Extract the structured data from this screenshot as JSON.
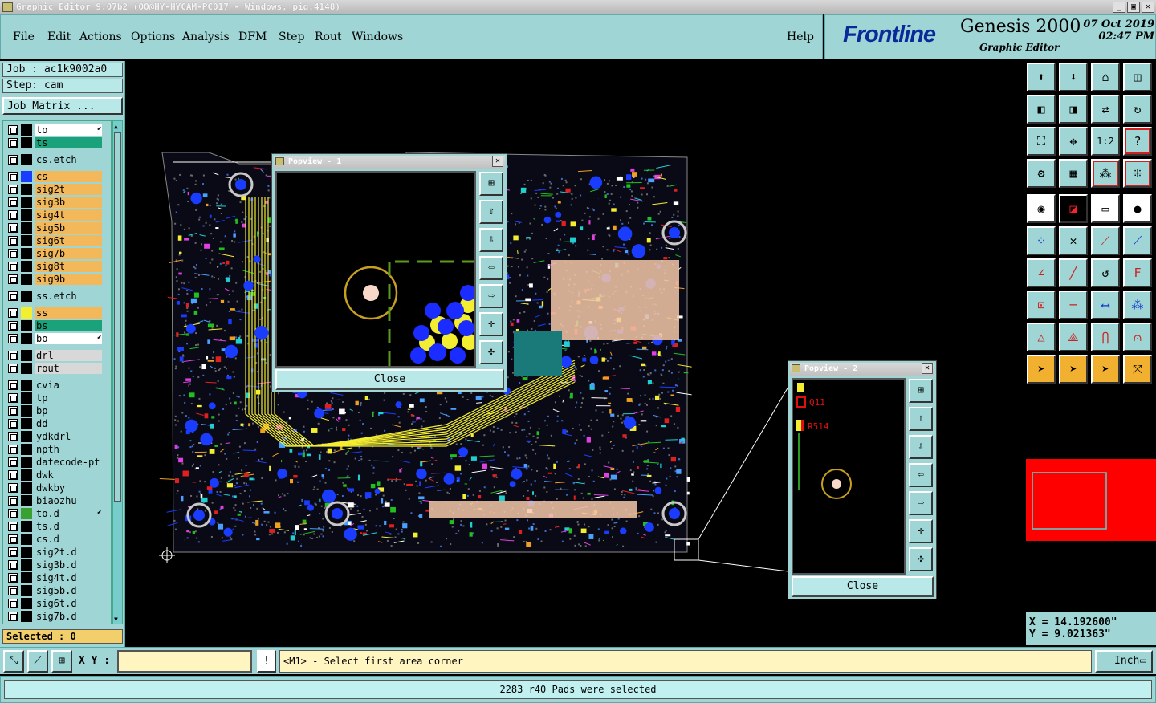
{
  "window": {
    "title": "Graphic Editor 9.07b2 (OO@HY-HYCAM-PC017 - Windows, pid:4148)"
  },
  "menu": {
    "items": [
      "File",
      "Edit",
      "Actions",
      "Options",
      "Analysis",
      "DFM",
      "Step",
      "Rout",
      "Windows"
    ],
    "help": "Help"
  },
  "brand": {
    "logo": "Frontline",
    "product": "Genesis 2000",
    "subtitle": "Graphic Editor",
    "date": "07 Oct 2019",
    "time": "02:47 PM"
  },
  "job": {
    "job": "Job : ac1k9002a0",
    "step": "Step: cam",
    "matrix_button": "Job Matrix ..."
  },
  "layers": [
    {
      "name": "to",
      "bg": "#ffffff",
      "swatch": "#000000",
      "arrow": true
    },
    {
      "name": "ts",
      "bg": "#1aa37a",
      "swatch": "#000000"
    },
    {
      "name": "cs.etch",
      "bg": "#9fd5d5",
      "swatch": "#000000",
      "gap": true
    },
    {
      "name": "cs",
      "bg": "#f2b85a",
      "swatch": "#1a3cff",
      "gap": true
    },
    {
      "name": "sig2t",
      "bg": "#f2b85a",
      "swatch": "#000000"
    },
    {
      "name": "sig3b",
      "bg": "#f2b85a",
      "swatch": "#000000"
    },
    {
      "name": "sig4t",
      "bg": "#f2b85a",
      "swatch": "#000000"
    },
    {
      "name": "sig5b",
      "bg": "#f2b85a",
      "swatch": "#000000"
    },
    {
      "name": "sig6t",
      "bg": "#f2b85a",
      "swatch": "#000000"
    },
    {
      "name": "sig7b",
      "bg": "#f2b85a",
      "swatch": "#000000"
    },
    {
      "name": "sig8t",
      "bg": "#f2b85a",
      "swatch": "#000000"
    },
    {
      "name": "sig9b",
      "bg": "#f2b85a",
      "swatch": "#000000"
    },
    {
      "name": "ss.etch",
      "bg": "#9fd5d5",
      "swatch": "#000000",
      "gap": true
    },
    {
      "name": "ss",
      "bg": "#f2b85a",
      "swatch": "#f4ee30",
      "gap": true
    },
    {
      "name": "bs",
      "bg": "#1aa37a",
      "swatch": "#000000"
    },
    {
      "name": "bo",
      "bg": "#ffffff",
      "swatch": "#000000",
      "arrow": true
    },
    {
      "name": "drl",
      "bg": "#d8d8d8",
      "swatch": "#000000",
      "gap": true
    },
    {
      "name": "rout",
      "bg": "#d8d8d8",
      "swatch": "#000000"
    },
    {
      "name": "cvia",
      "bg": "#9fd5d5",
      "swatch": "#000000",
      "gap": true
    },
    {
      "name": "tp",
      "bg": "#9fd5d5",
      "swatch": "#000000"
    },
    {
      "name": "bp",
      "bg": "#9fd5d5",
      "swatch": "#000000"
    },
    {
      "name": "dd",
      "bg": "#9fd5d5",
      "swatch": "#000000"
    },
    {
      "name": "ydkdrl",
      "bg": "#9fd5d5",
      "swatch": "#000000"
    },
    {
      "name": "npth",
      "bg": "#9fd5d5",
      "swatch": "#000000"
    },
    {
      "name": "datecode-pt",
      "bg": "#9fd5d5",
      "swatch": "#000000"
    },
    {
      "name": "dwk",
      "bg": "#9fd5d5",
      "swatch": "#000000"
    },
    {
      "name": "dwkby",
      "bg": "#9fd5d5",
      "swatch": "#000000"
    },
    {
      "name": "biaozhu",
      "bg": "#9fd5d5",
      "swatch": "#000000"
    },
    {
      "name": "to.d",
      "bg": "#9fd5d5",
      "swatch": "#3aa030",
      "arrow": true
    },
    {
      "name": "ts.d",
      "bg": "#9fd5d5",
      "swatch": "#000000"
    },
    {
      "name": "cs.d",
      "bg": "#9fd5d5",
      "swatch": "#000000"
    },
    {
      "name": "sig2t.d",
      "bg": "#9fd5d5",
      "swatch": "#000000"
    },
    {
      "name": "sig3b.d",
      "bg": "#9fd5d5",
      "swatch": "#000000"
    },
    {
      "name": "sig4t.d",
      "bg": "#9fd5d5",
      "swatch": "#000000"
    },
    {
      "name": "sig5b.d",
      "bg": "#9fd5d5",
      "swatch": "#000000"
    },
    {
      "name": "sig6t.d",
      "bg": "#9fd5d5",
      "swatch": "#000000"
    },
    {
      "name": "sig7b.d",
      "bg": "#9fd5d5",
      "swatch": "#000000"
    }
  ],
  "selected": "Selected : 0",
  "popview1": {
    "title": "Popview - 1",
    "close": "Close"
  },
  "popview2": {
    "title": "Popview - 2",
    "close": "Close",
    "labels": [
      "Q11",
      "R514"
    ]
  },
  "coords": {
    "x": "X = 14.192600\"",
    "y": "Y = 9.021363\""
  },
  "bottom": {
    "xy_label": "X Y :",
    "xy_value": "",
    "prompt": "<M1> - Select first area corner",
    "units": "Inch"
  },
  "status": "2283 r40 Pads were selected",
  "colors": {
    "panel": "#9fd5d5",
    "accent": "#f2b85a",
    "green": "#1aa37a"
  }
}
